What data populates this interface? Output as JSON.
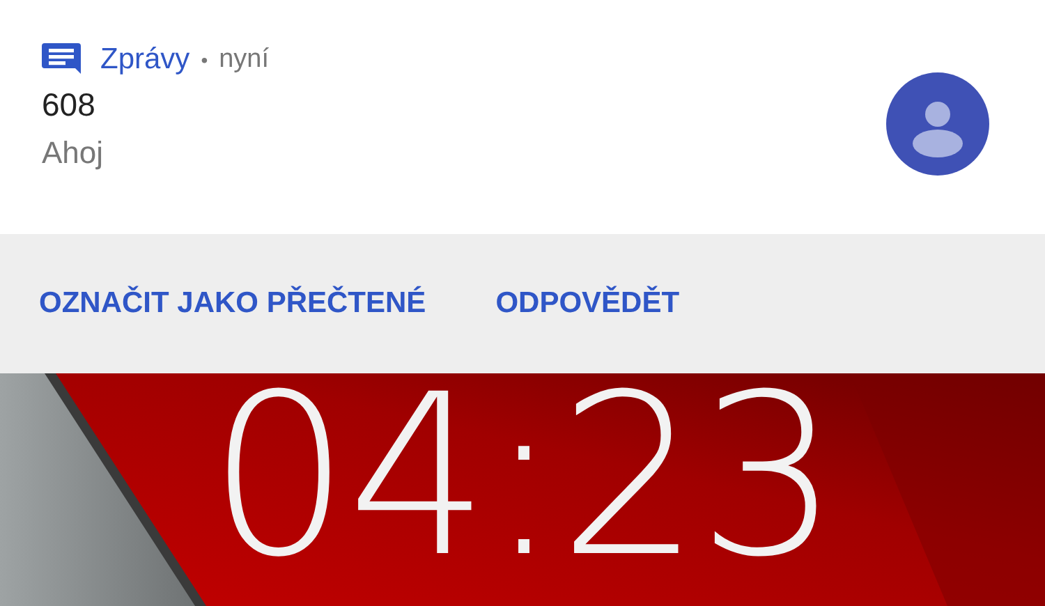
{
  "notification": {
    "app_name": "Zprávy",
    "separator": "•",
    "time": "nyní",
    "title": "608",
    "text": "Ahoj"
  },
  "actions": [
    "OZNAČIT JAKO PŘEČTENÉ",
    "ODPOVĚDĚT"
  ],
  "lock_screen": {
    "clock": "04:23"
  }
}
